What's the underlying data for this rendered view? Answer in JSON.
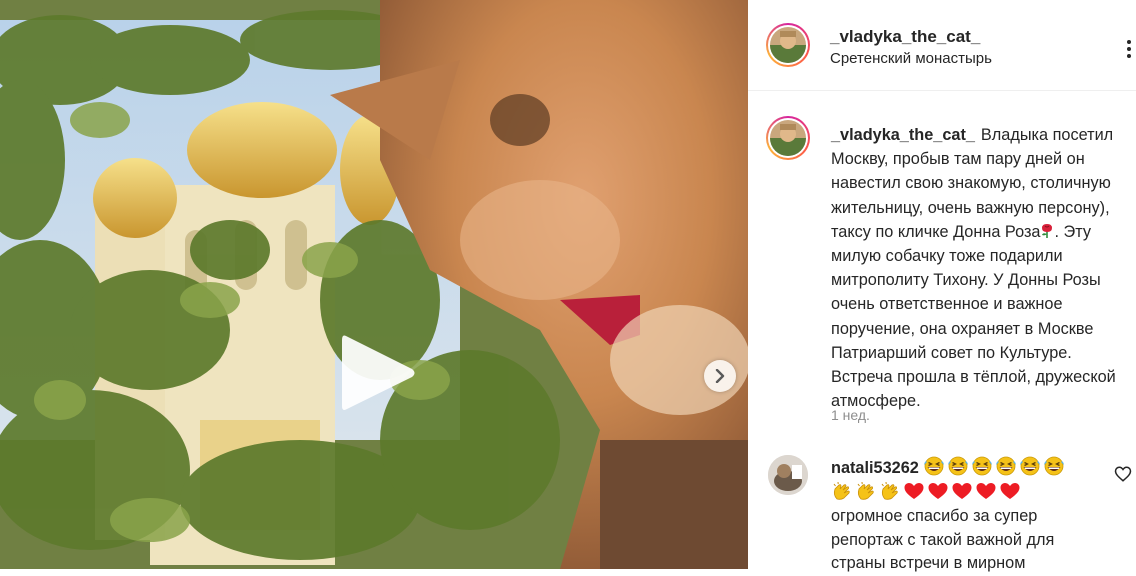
{
  "post": {
    "username": "_vladyka_the_cat_",
    "location": "Сретенский монастырь"
  },
  "caption": {
    "username": "_vladyka_the_cat_",
    "text_part1": "Владыка посетил Москву, пробыв там пару дней он навестил свою знакомую, столичную жительницу, очень важную персону), таксу по кличке Донна Роза",
    "text_part2": ". Эту милую собачку тоже подарили митрополиту Тихону. У Донны Розы очень ответственное и важное поручение, она охраняет в Москве Патриарший совет по Культуре. Встреча прошла в тёплой, дружеской атмосфере.",
    "time": "1 нед."
  },
  "comment": {
    "username": "natali53262",
    "emoji_line_1": [
      "grinning-squinting-face",
      "grinning-squinting-face",
      "grinning-squinting-face",
      "grinning-squinting-face",
      "grinning-squinting-face",
      "grinning-squinting-face"
    ],
    "emoji_line_2": [
      "clapping-hands",
      "clapping-hands",
      "clapping-hands",
      "red-heart",
      "red-heart",
      "red-heart",
      "red-heart",
      "red-heart"
    ],
    "text": "огромное спасибо за супер репортаж с такой важной для страны встречи в мирном"
  },
  "icons": {
    "play": "play-icon",
    "next": "chevron-right-icon",
    "more": "more-dots-icon",
    "like": "heart-outline-icon"
  },
  "colors": {
    "text": "#262626",
    "muted": "#8e8e8e",
    "heart": "#ed1c24",
    "emoji_yellow": "#f5c218"
  }
}
